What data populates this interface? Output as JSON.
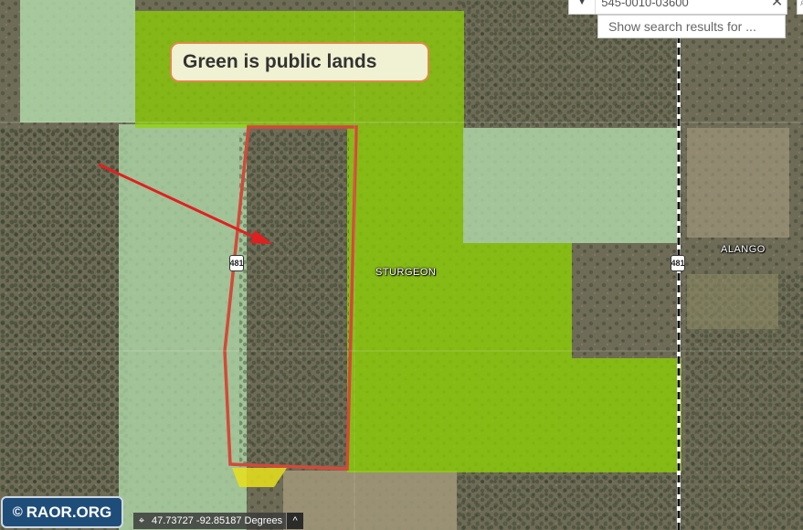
{
  "callout": {
    "text": "Green is public lands"
  },
  "places": {
    "sturgeon": "STURGEON",
    "alango": "ALANGO"
  },
  "roads": {
    "west_shield": "481",
    "east_shield": "481"
  },
  "search": {
    "value": "545-0010-03600",
    "suggestion": "Show search results for ..."
  },
  "logo": {
    "symbol": "©",
    "text": "RAOR.ORG"
  },
  "coordinates": {
    "text": "47.73727 -92.85187 Degrees"
  },
  "colors": {
    "public_land_bright": "#8fd400",
    "public_land_pale": "#b7e3b0",
    "parcel_outline": "#d24a3a",
    "arrow": "#e02020",
    "yellow_parcel": "#e8df1a"
  },
  "icons": {
    "search_dropdown": "chevron-down-icon",
    "search_clear": "close-icon",
    "coords_crosshair": "crosshair-icon",
    "coords_toggle": "chevron-up-icon"
  }
}
